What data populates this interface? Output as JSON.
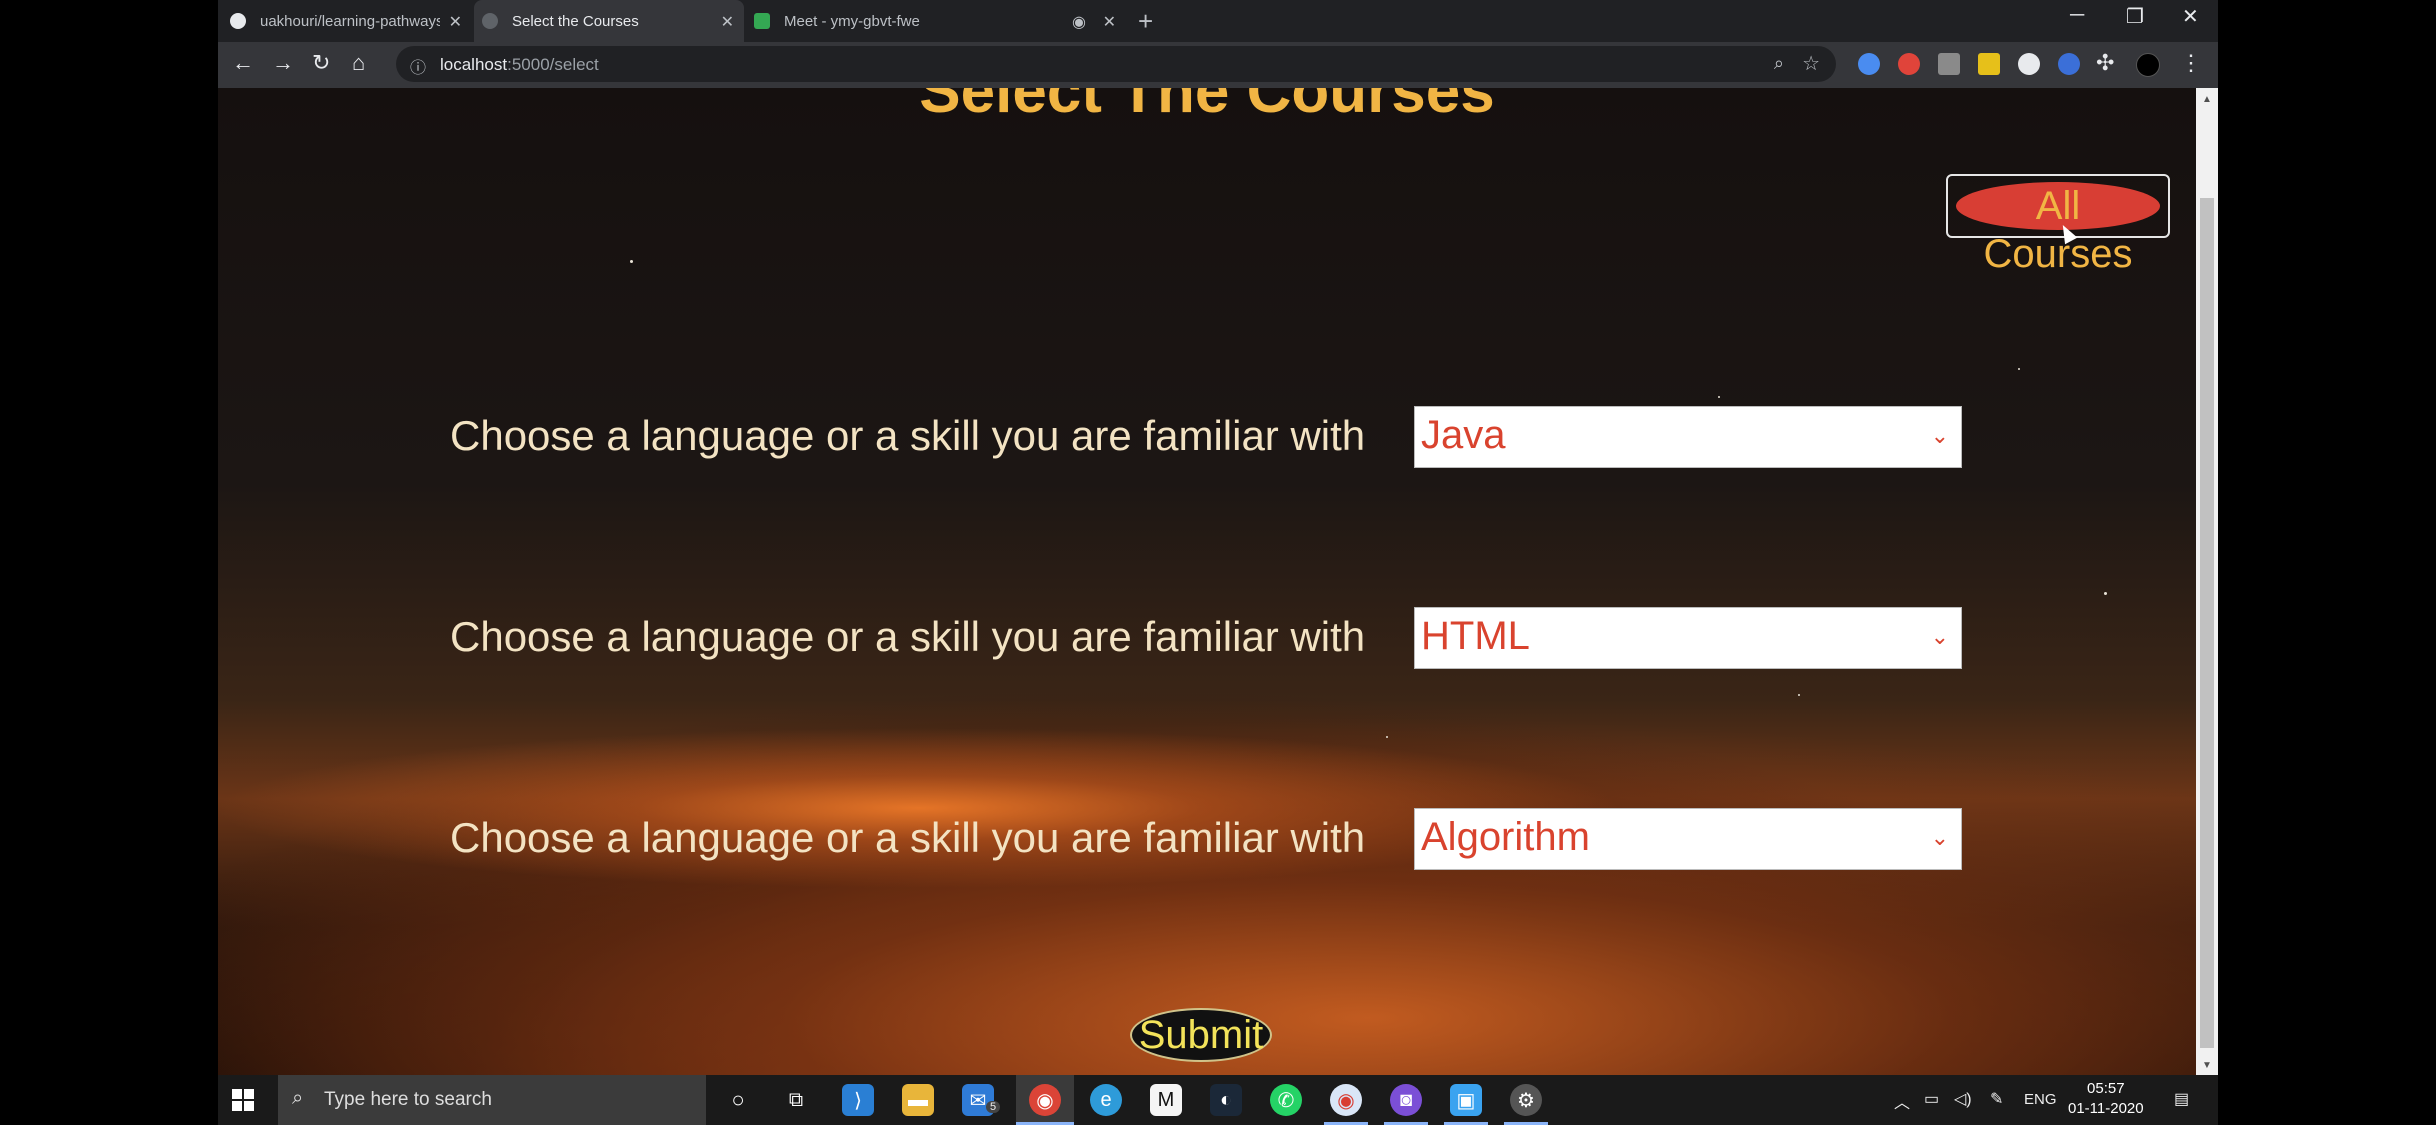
{
  "browser": {
    "tabs": [
      {
        "label": "uakhouri/learning-pathways-co",
        "icon": "github-icon",
        "active": false
      },
      {
        "label": "Select the Courses",
        "icon": "globe-icon",
        "active": true
      },
      {
        "label": "Meet - ymy-gbvt-fwe",
        "icon": "meet-icon",
        "active": false
      }
    ],
    "url_host": "localhost",
    "url_path": ":5000/select",
    "window_controls": {
      "minimize": "─",
      "restore": "❐",
      "close": "✕"
    }
  },
  "page": {
    "heading": "Select The Courses",
    "all_courses_label": "All Courses",
    "rows": [
      {
        "label": "Choose a language or a skill you are familiar with",
        "selected": "Java"
      },
      {
        "label": "Choose a language or a skill you are familiar with",
        "selected": "HTML"
      },
      {
        "label": "Choose a language or a skill you are familiar with",
        "selected": "Algorithm"
      }
    ],
    "submit_label": "Submit"
  },
  "taskbar": {
    "search_placeholder": "Type here to search",
    "mail_badge": "5",
    "lang": "ENG",
    "time": "05:57",
    "date": "01-11-2020"
  },
  "colors": {
    "heading": "#f1b544",
    "select_text": "#d9432e",
    "all_courses_bg": "#d83e34",
    "label_text": "#f3e3c3",
    "submit_text": "#f3e35a"
  }
}
